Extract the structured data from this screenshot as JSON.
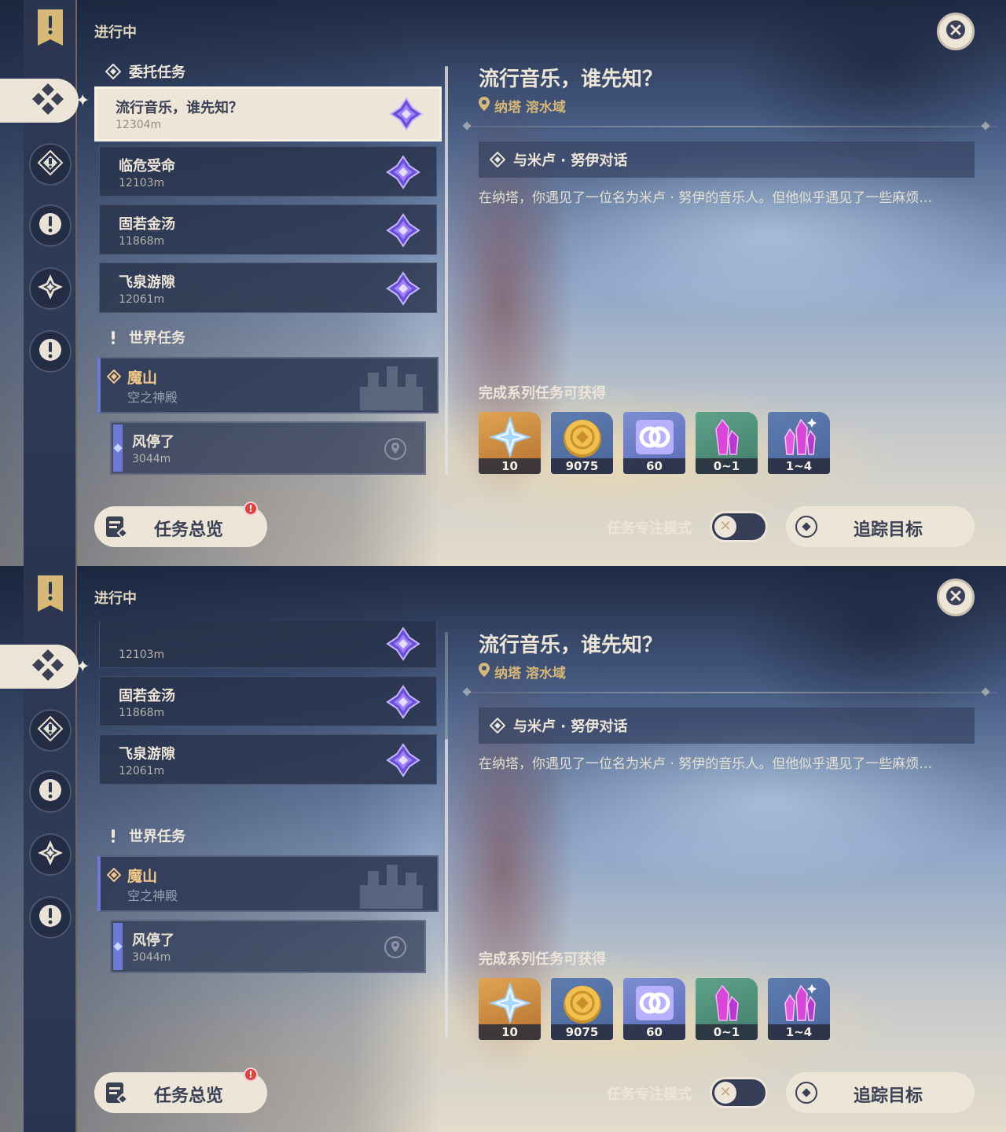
{
  "panels": [
    {
      "in_progress_label": "进行中",
      "commission_header": "委托任务",
      "world_header": "世界任务",
      "quests": [
        {
          "name": "流行音乐，谁先知？",
          "distance": "12304m"
        },
        {
          "name": "临危受命",
          "distance": "12103m"
        },
        {
          "name": "固若金汤",
          "distance": "11868m"
        },
        {
          "name": "飞泉游隙",
          "distance": "12061m"
        }
      ],
      "world_quest": {
        "name": "魔山",
        "sub": "空之神殿"
      },
      "sub_quest": {
        "name": "风停了",
        "distance": "3044m"
      },
      "scroll_progress": 0
    },
    {
      "in_progress_label": "进行中",
      "world_header": "世界任务",
      "quests": [
        {
          "name": "",
          "distance": "12103m"
        },
        {
          "name": "固若金汤",
          "distance": "11868m"
        },
        {
          "name": "飞泉游隙",
          "distance": "12061m"
        }
      ],
      "world_quest": {
        "name": "魔山",
        "sub": "空之神殿"
      },
      "sub_quest": {
        "name": "风停了",
        "distance": "3044m"
      },
      "scroll_progress": 1
    }
  ],
  "detail": {
    "title": "流行音乐，谁先知？",
    "location": "纳塔 溶水域",
    "objective": "与米卢 · 努伊对话",
    "description": "在纳塔，你遇见了一位名为米卢 · 努伊的音乐人。但他似乎遇见了一些麻烦…",
    "reward_title": "完成系列任务可获得",
    "rewards": [
      {
        "icon": "primogem-icon",
        "count": "10",
        "color": "#d08a3e"
      },
      {
        "icon": "mora-icon",
        "count": "9075",
        "color": "#5d7cae"
      },
      {
        "icon": "adventure-exp-icon",
        "count": "60",
        "color": "#6f80c8"
      },
      {
        "icon": "crystal-icon",
        "count": "0~1",
        "color": "#4f9078"
      },
      {
        "icon": "crystal-cluster-icon",
        "count": "1~4",
        "color": "#5d7cae"
      }
    ]
  },
  "bottom": {
    "overview_label": "任务总览",
    "notify": "!",
    "focus_mode_label": "任务专注模式",
    "toggle_state": "off",
    "track_label": "追踪目标"
  },
  "colors": {
    "accent_gold": "#d8b877",
    "cream": "#ece5d8",
    "world_accent": "#6c7ad6"
  }
}
